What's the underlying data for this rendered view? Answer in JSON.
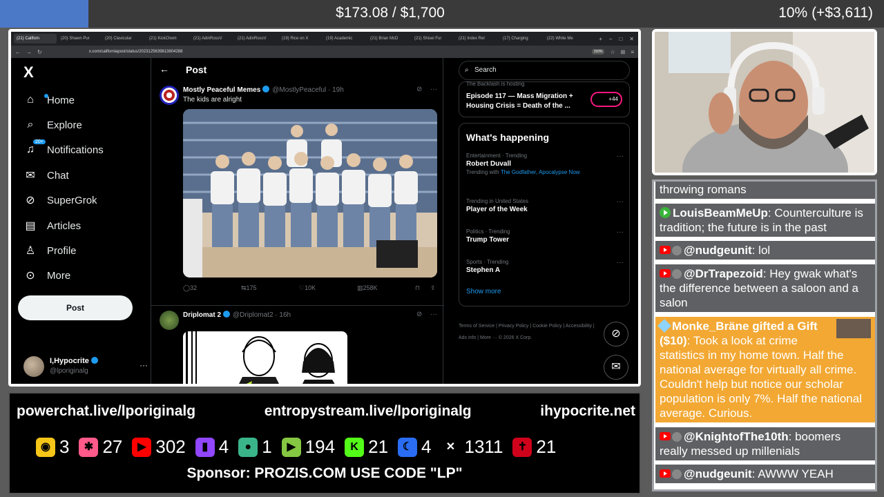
{
  "goal": {
    "amount": "$173.08 / $1,700",
    "percent_text": "10% (+$3,611)",
    "progress": 0.1
  },
  "browser": {
    "tabs": [
      "(21) Californ",
      "(20) Shawn Pur",
      "(20) Clavicular",
      "(21) KickChem",
      "(21) AdinRossV",
      "(21) AdinRossV",
      "(19) Rice on X",
      "(19) Academic",
      "(21) Brian McD",
      "(21) Shisei Fur",
      "(21) Index Rel",
      "(17) Charging",
      "(22) White Me"
    ],
    "url": "x.com/californiapost/status/2023125639813804288",
    "zoom": "150%"
  },
  "nav": {
    "logo": "X",
    "items": [
      {
        "label": "Home",
        "icon": "home-icon",
        "glyph": "⌂"
      },
      {
        "label": "Explore",
        "icon": "search-icon",
        "glyph": "⌕"
      },
      {
        "label": "Notifications",
        "icon": "bell-icon",
        "glyph": "♫",
        "badge": "20+"
      },
      {
        "label": "Chat",
        "icon": "mail-icon",
        "glyph": "✉"
      },
      {
        "label": "SuperGrok",
        "icon": "grok-icon",
        "glyph": "⊘"
      },
      {
        "label": "Articles",
        "icon": "article-icon",
        "glyph": "▤"
      },
      {
        "label": "Profile",
        "icon": "person-icon",
        "glyph": "♙"
      },
      {
        "label": "More",
        "icon": "more-circle-icon",
        "glyph": "⊙"
      }
    ],
    "post_button": "Post",
    "account": {
      "name": "I,Hypocrite",
      "handle": "@lporiginalg"
    }
  },
  "timeline": {
    "header": "Post",
    "post1": {
      "name": "Mostly Peaceful Memes",
      "handle": "@MostlyPeaceful · 19h",
      "text": "The kids are alright",
      "stats": {
        "replies": "32",
        "reposts": "175",
        "likes": "10K",
        "views": "258K"
      }
    },
    "post2": {
      "name": "Driplomat 2",
      "handle": "@Driplomat2 · 16h"
    }
  },
  "right": {
    "search_placeholder": "Search",
    "episode": {
      "source": "The Backlash  is hosting",
      "title": "Episode 117 — Mass Migration + Housing Crisis = Death of the ...",
      "pill": "+44"
    },
    "happening_title": "What's happening",
    "trends": [
      {
        "category": "Entertainment · Trending",
        "title": "Robert Duvall",
        "with_prefix": "Trending with",
        "with": "The Godfather, Apocalypse Now"
      },
      {
        "category": "Trending in United States",
        "title": "Player of the Week"
      },
      {
        "category": "Politics · Trending",
        "title": "Trump Tower"
      },
      {
        "category": "Sports · Trending",
        "title": "Stephen A"
      }
    ],
    "show_more": "Show more",
    "footer": "Terms of Service  |  Privacy Policy  |  Cookie Policy  |  Accessibility  |  Ads info  |  More ···  © 2026 X Corp."
  },
  "banner": {
    "links": [
      "powerchat.live/lporiginalg",
      "entropystream.live/lporiginalg",
      "ihypocrite.net"
    ],
    "counts": [
      {
        "platform": "rumble-gold-icon",
        "value": "3",
        "color": "#f5c518"
      },
      {
        "platform": "pink-app-icon",
        "value": "27",
        "color": "#ff5a8a"
      },
      {
        "platform": "youtube-icon",
        "value": "302",
        "color": "#ff0000"
      },
      {
        "platform": "twitch-icon",
        "value": "4",
        "color": "#9146ff"
      },
      {
        "platform": "globe-app-icon",
        "value": "1",
        "color": "#3ab58a"
      },
      {
        "platform": "rumble-icon",
        "value": "194",
        "color": "#85c742"
      },
      {
        "platform": "kick-icon",
        "value": "21",
        "color": "#53fc18"
      },
      {
        "platform": "moon-app-icon",
        "value": "4",
        "color": "#2a6df4"
      },
      {
        "platform": "x-icon",
        "value": "1311",
        "color": "#ffffff"
      },
      {
        "platform": "cross-app-icon",
        "value": "21",
        "color": "#d0021b"
      }
    ],
    "sponsor": "Sponsor: PROZIS.COM USE CODE \"LP\""
  },
  "chat": [
    {
      "user": "",
      "text": "throwing romans",
      "platform": "none"
    },
    {
      "user": "LouisBeamMeUp",
      "text": ": Counterculture is tradition; the future is in the past",
      "platform": "rumble"
    },
    {
      "user": "@nudgeunit",
      "text": ": lol",
      "platform": "youtube"
    },
    {
      "user": "@DrTrapezoid",
      "text": ": Hey gwak what's the difference between a saloon and a salon",
      "platform": "youtube"
    },
    {
      "user": "Monke_Bräne gifted a Gift ($10)",
      "text": ": Took a look at crime statistics in my home town. Half the national average for virtually all crime. Couldn't help but notice our scholar population is only 7%. Half the national average. Curious.",
      "platform": "gift"
    },
    {
      "user": "@KnightofThe10th",
      "text": ": boomers really messed up millenials",
      "platform": "youtube"
    },
    {
      "user": "@nudgeunit",
      "text": ": AWWW YEAH",
      "platform": "youtube"
    }
  ]
}
